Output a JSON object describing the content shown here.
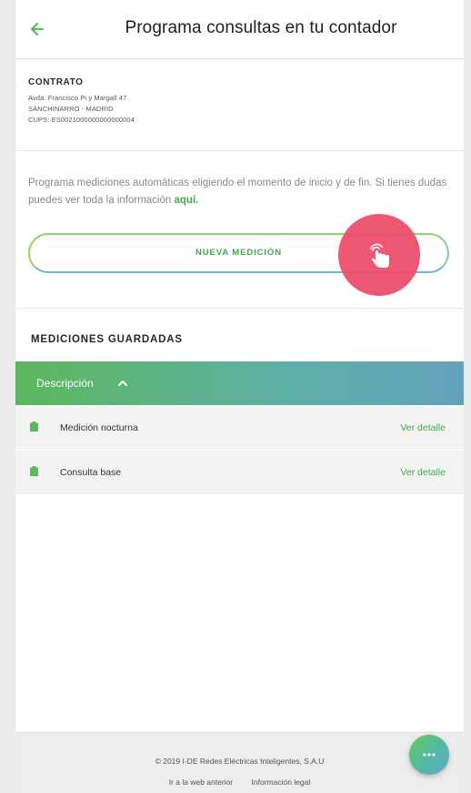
{
  "header": {
    "title": "Programa consultas en tu contador",
    "back_icon": "arrow-left-icon",
    "accent_color": "#5cb85c"
  },
  "contract": {
    "title": "CONTRATO",
    "address": "Avda. Francisco Pi y Margall 47",
    "city": "SANCHINARRO - MADRID",
    "cups": "CUPS: ES0021000000000000004"
  },
  "programa": {
    "text": "Programa mediciones automáticas eligiendo el momento de inicio y de fin. Si tienes dudas puedes ver toda la información",
    "link": "aquí.",
    "button_label": "NUEVA MEDICIÓN",
    "touch_icon": "tap-hand-icon"
  },
  "saved": {
    "title": "MEDICIONES GUARDADAS",
    "column_header": "Descripción",
    "rows": [
      {
        "label": "Medición nocturna",
        "link": "Ver detalle",
        "icon": "battery-icon"
      },
      {
        "label": "Consulta base",
        "link": "Ver detalle",
        "icon": "battery-icon"
      }
    ]
  },
  "footer": {
    "copyright": "© 2019 I-DE Redes Eléctricas Inteligentes, S.A.U",
    "link_prev": "Ir a la web anterior",
    "link_legal": "Información legal"
  },
  "fab": {
    "icon": "chat-bubble-icon"
  },
  "colors": {
    "green": "#43a850",
    "pink": "#ee4f6c",
    "blue": "#63a2bd"
  }
}
